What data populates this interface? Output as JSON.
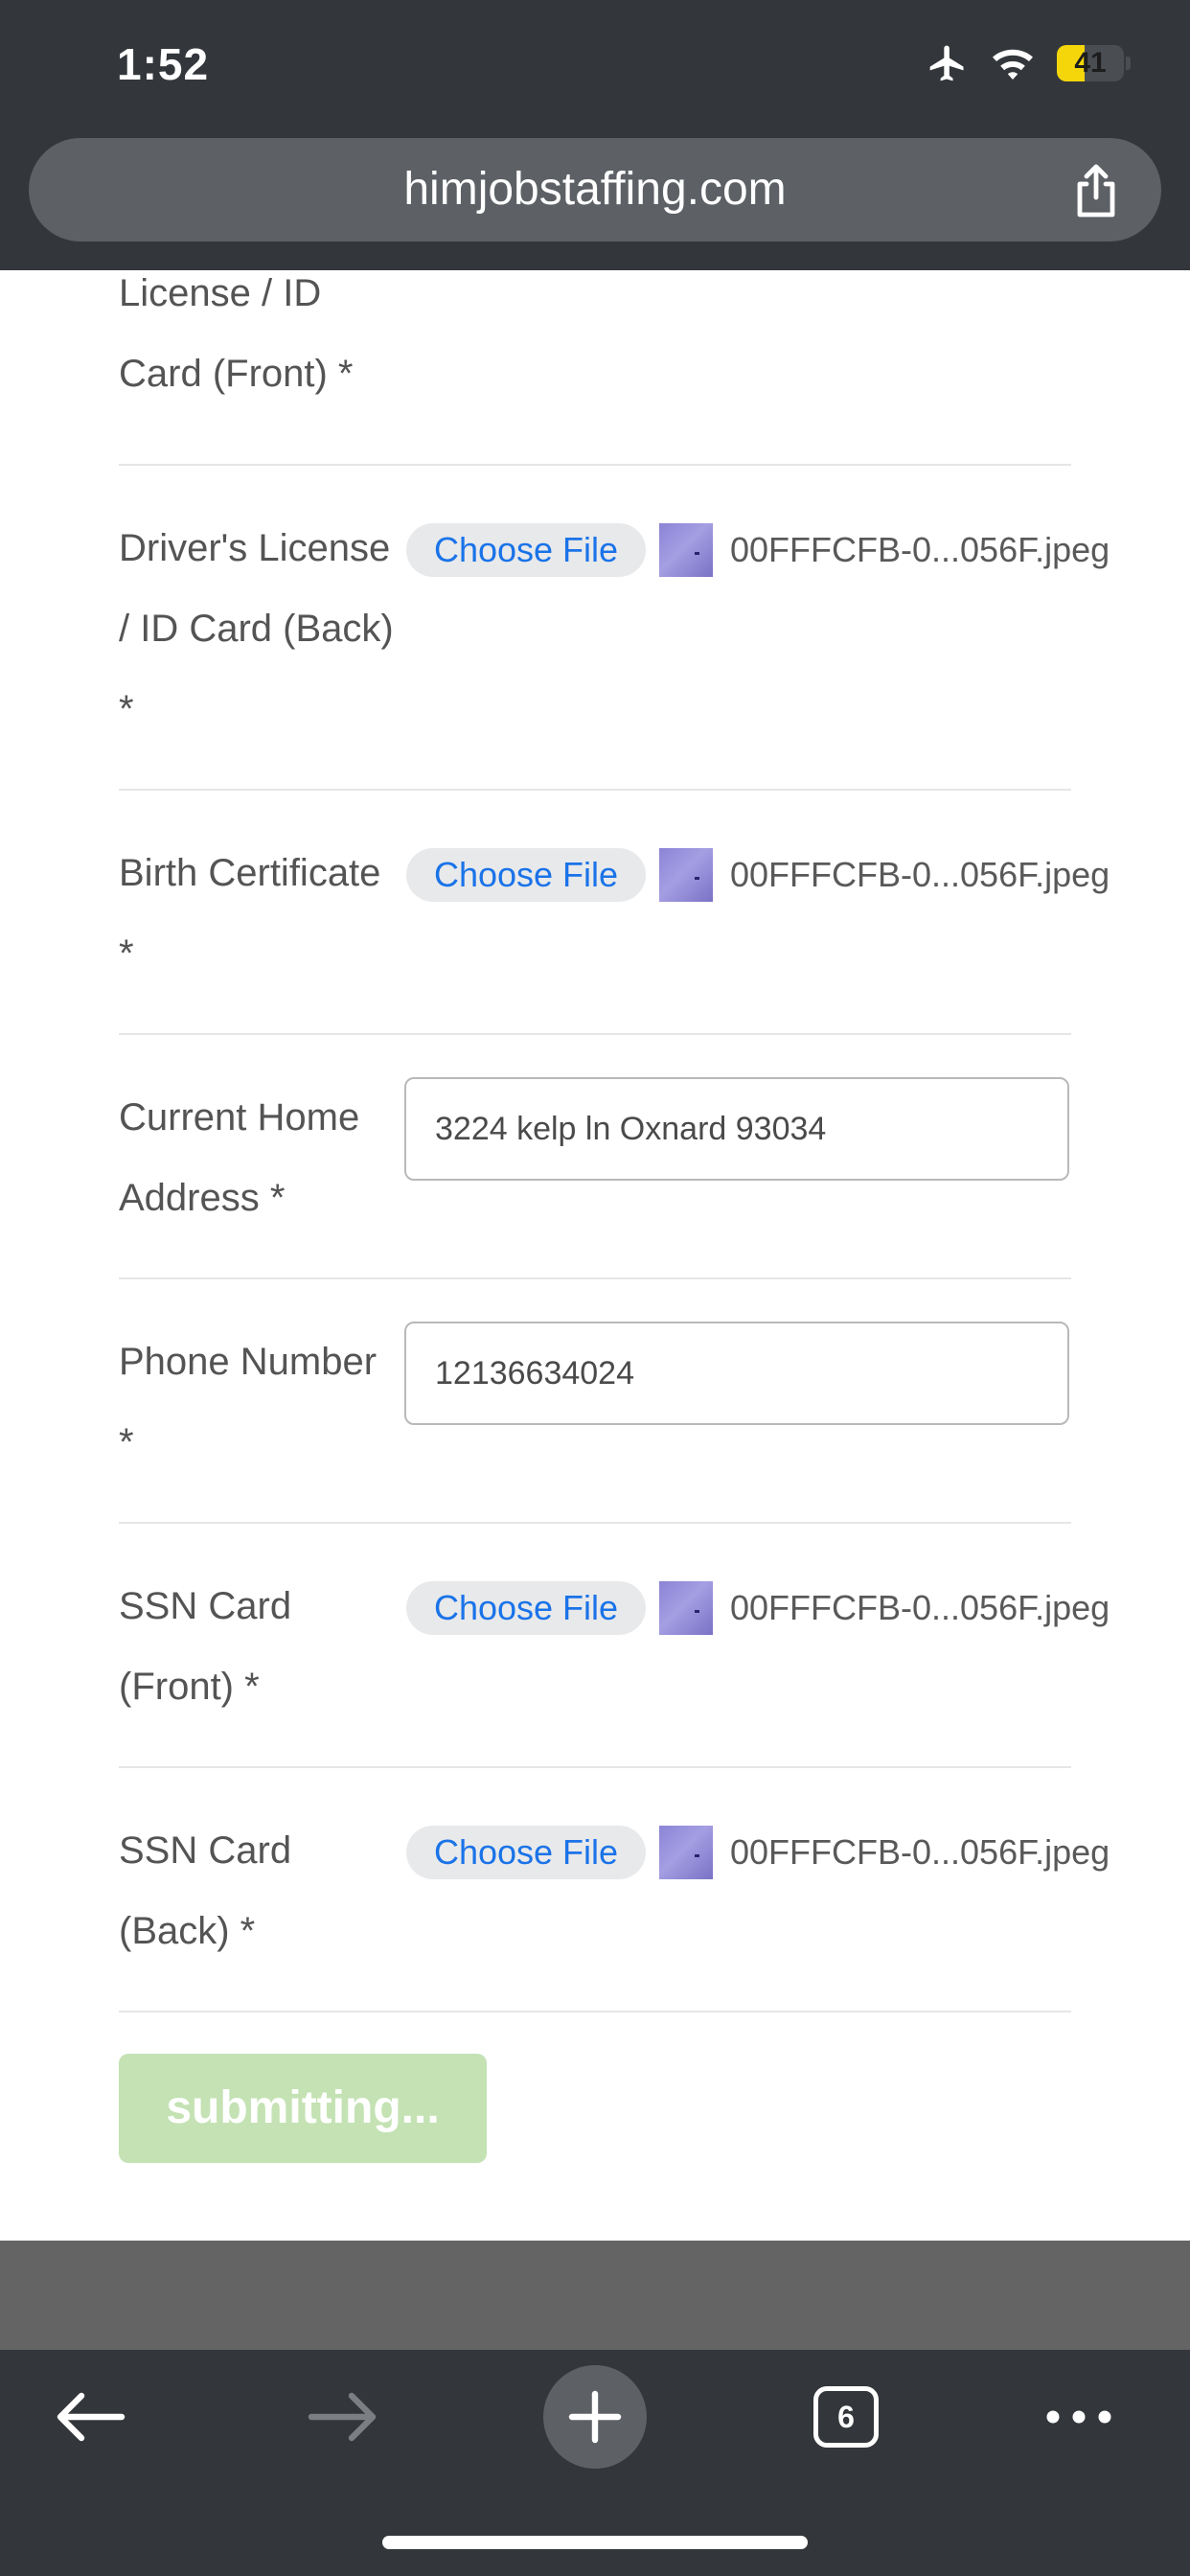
{
  "status_bar": {
    "time": "1:52",
    "battery_level": "41",
    "icons": [
      "airplane-icon",
      "wifi-icon",
      "battery-icon"
    ]
  },
  "browser": {
    "url": "himjobstaffing.com",
    "tab_count": "6"
  },
  "form": {
    "fields": [
      {
        "label": "License / ID Card (Front) *",
        "type": "file"
      },
      {
        "label": "Driver's License / ID Card (Back) *",
        "type": "file",
        "button": "Choose File",
        "file_name": "00FFFCFB-0...056F.jpeg"
      },
      {
        "label": "Birth Certificate *",
        "type": "file",
        "button": "Choose File",
        "file_name": "00FFFCFB-0...056F.jpeg"
      },
      {
        "label": "Current Home Address *",
        "type": "text",
        "value": "3224 kelp ln Oxnard 93034"
      },
      {
        "label": "Phone Number *",
        "type": "text",
        "value": "12136634024"
      },
      {
        "label": "SSN Card (Front) *",
        "type": "file",
        "button": "Choose File",
        "file_name": "00FFFCFB-0...056F.jpeg"
      },
      {
        "label": "SSN Card (Back) *",
        "type": "file",
        "button": "Choose File",
        "file_name": "00FFFCFB-0...056F.jpeg"
      }
    ],
    "submit_label": "submitting..."
  },
  "colors": {
    "chrome_bg": "#33373b",
    "url_bar_bg": "#5d6166",
    "link_blue": "#1a73e8",
    "submit_bg": "#c4e2b3",
    "battery_yellow": "#f5d60a"
  }
}
